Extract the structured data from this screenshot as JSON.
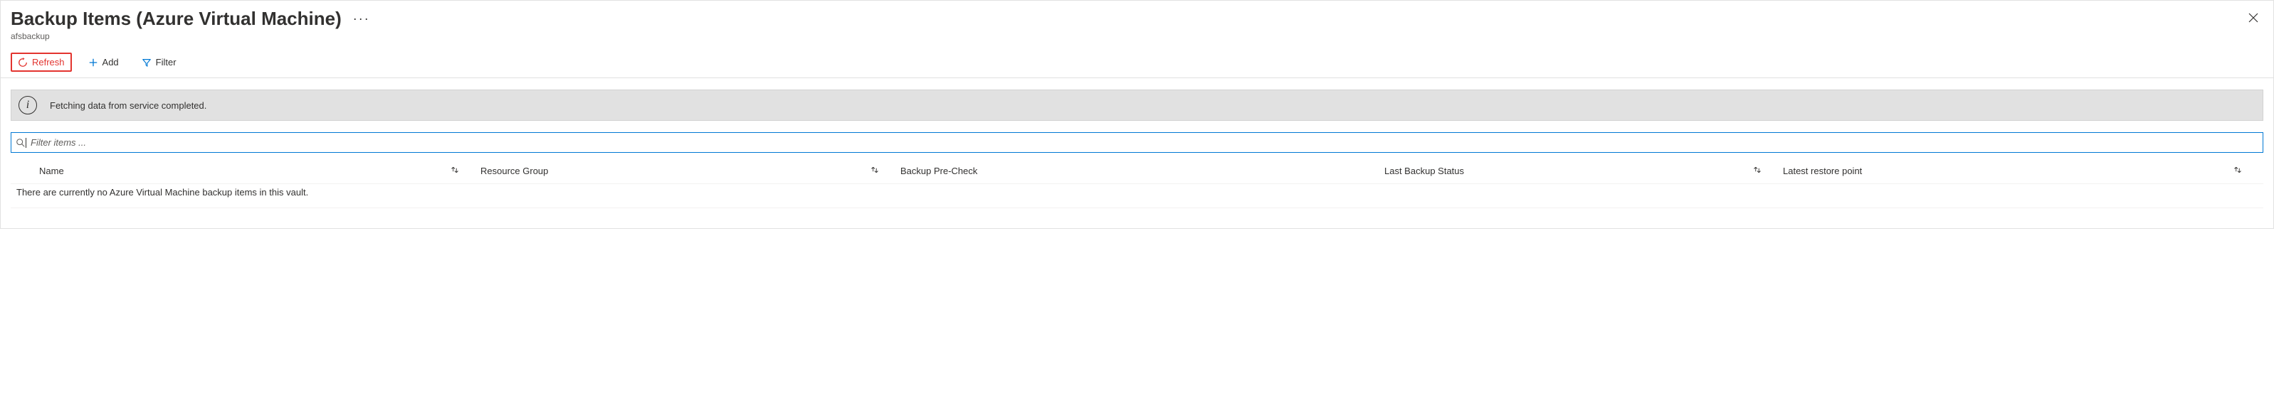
{
  "header": {
    "title": "Backup Items (Azure Virtual Machine)",
    "more": "···",
    "subtitle": "afsbackup"
  },
  "toolbar": {
    "refresh": "Refresh",
    "add": "Add",
    "filter": "Filter"
  },
  "info": {
    "message": "Fetching data from service completed."
  },
  "filter": {
    "placeholder": "Filter items ..."
  },
  "columns": {
    "name": "Name",
    "rg": "Resource Group",
    "pre": "Backup Pre-Check",
    "last": "Last Backup Status",
    "restore": "Latest restore point"
  },
  "empty": "There are currently no Azure Virtual Machine backup items in this vault."
}
